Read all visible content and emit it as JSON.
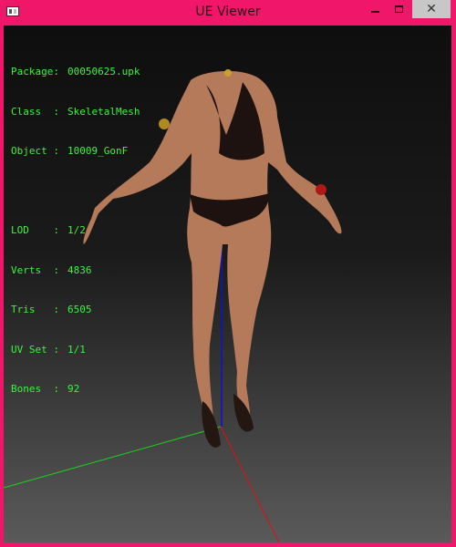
{
  "window": {
    "title": "UE Viewer"
  },
  "info": {
    "package_label": "Package:",
    "package_value": "00050625.upk",
    "class_label": "Class  :",
    "class_value": "SkeletalMesh",
    "object_label": "Object :",
    "object_value": "10009_GonF",
    "lod_label": "LOD    :",
    "lod_value": "1/2",
    "verts_label": "Verts  :",
    "verts_value": "4836",
    "tris_label": "Tris   :",
    "tris_value": "6505",
    "uvset_label": "UV Set :",
    "uvset_value": "1/1",
    "bones_label": "Bones  :",
    "bones_value": "92"
  },
  "colors": {
    "titlebar": "#f0166a",
    "hud_text": "#3df23d",
    "axis_x": "#e01010",
    "axis_y": "#1bd31b",
    "axis_z": "#1010d0"
  },
  "icons": {
    "app": "app-window-icon",
    "minimize": "minimize-icon",
    "maximize": "maximize-icon",
    "close": "close-icon"
  }
}
